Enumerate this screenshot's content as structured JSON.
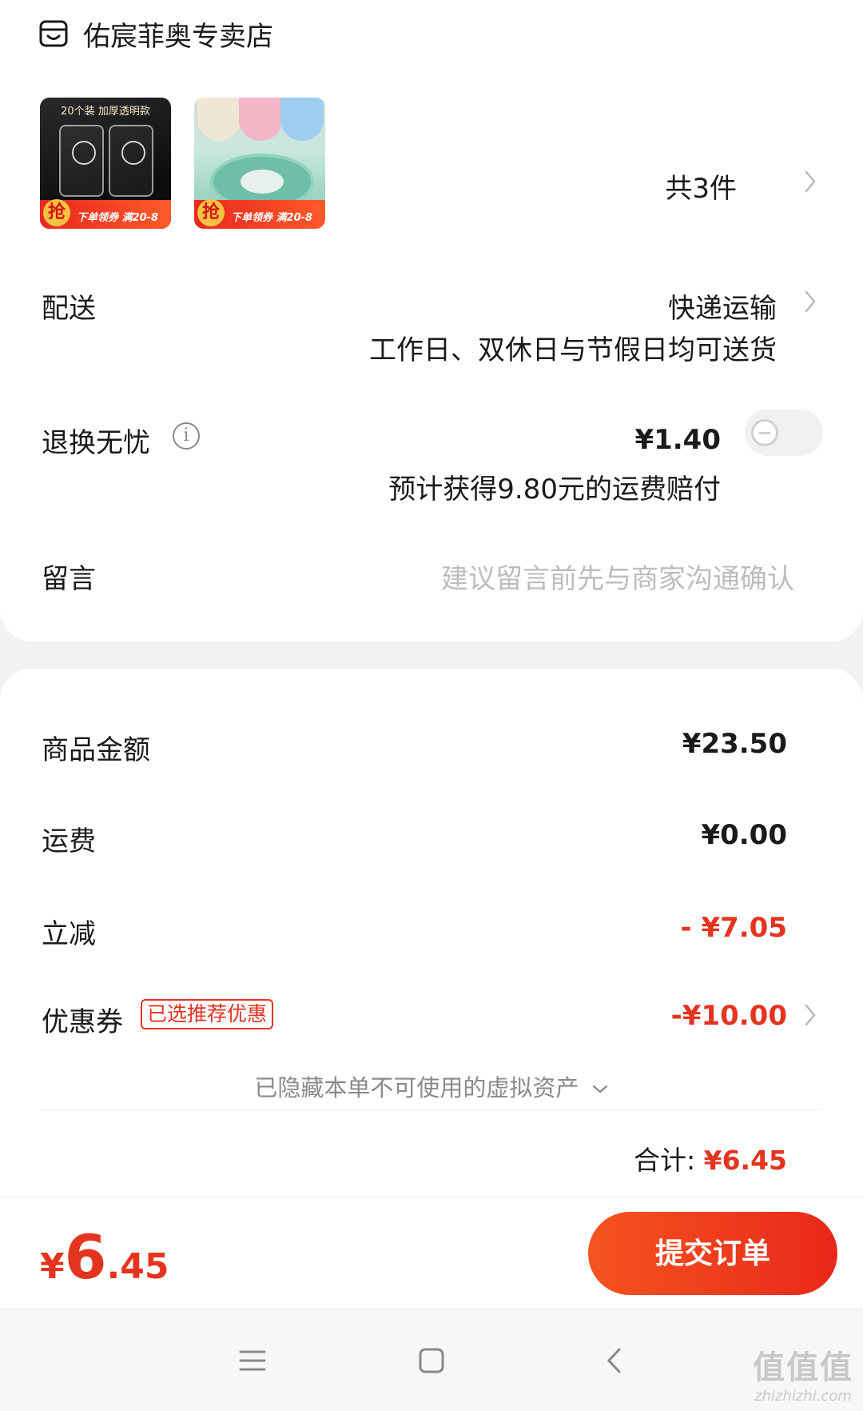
{
  "store": {
    "icon": "store-icon",
    "name": "佑宸菲奥专卖店"
  },
  "products": {
    "thumb1": {
      "top_text": "20个装 加厚透明款",
      "badge": "抢",
      "promo": "下单领券 满20-8"
    },
    "thumb2": {
      "badge": "抢",
      "promo": "下单领券 满20-8"
    },
    "count_label": "共3件"
  },
  "delivery": {
    "label": "配送",
    "method": "快递运输",
    "note": "工作日、双休日与节假日均可送货"
  },
  "return_insurance": {
    "label": "退换无忧",
    "price": "¥1.40",
    "note": "预计获得9.80元的运费赔付",
    "toggle_on": false
  },
  "message": {
    "label": "留言",
    "placeholder": "建议留言前先与商家沟通确认"
  },
  "summary": {
    "goods_label": "商品金额",
    "goods_value": "¥23.50",
    "shipping_label": "运费",
    "shipping_value": "¥0.00",
    "discount_label": "立减",
    "discount_value": "- ¥7.05",
    "coupon_label": "优惠券",
    "coupon_tag": "已选推荐优惠",
    "coupon_value": "-¥10.00",
    "hidden_note": "已隐藏本单不可使用的虚拟资产",
    "total_label": "合计:",
    "total_value": "¥6.45"
  },
  "bottom_bar": {
    "price_currency": "¥",
    "price_int": "6",
    "price_dec": ".45",
    "submit_label": "提交订单"
  },
  "navbar": {
    "watermark": "值值值",
    "watermark_url": "zhizhizhi.com"
  },
  "colors": {
    "accent_red": "#e4341f",
    "submit_gradient_start": "#f4541f",
    "submit_gradient_end": "#e8281a"
  }
}
